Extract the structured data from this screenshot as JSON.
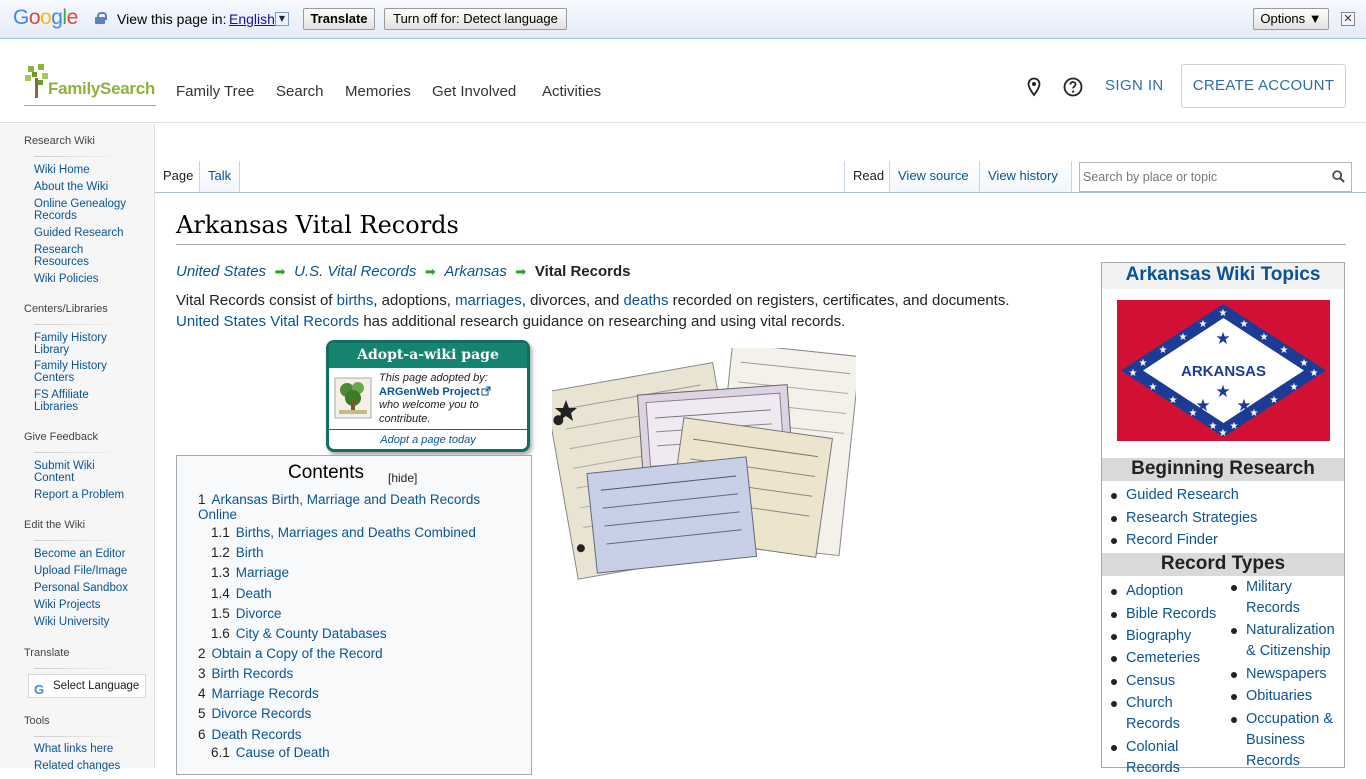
{
  "translate_bar": {
    "label": "View this page in:",
    "language": "English",
    "dropdown_glyph": "▼",
    "translate_button": "Translate",
    "turn_off_button": "Turn off for: Detect language",
    "options_button": "Options ▼",
    "close_glyph": "✕"
  },
  "header": {
    "logo_text": "FamilySearch",
    "nav": [
      "Family Tree",
      "Search",
      "Memories",
      "Get Involved",
      "Activities"
    ],
    "sign_in": "SIGN IN",
    "create_account": "CREATE ACCOUNT"
  },
  "sidebar": {
    "sections": [
      {
        "heading": "Research Wiki",
        "items": [
          "Wiki Home",
          "About the Wiki",
          "Online Genealogy Records",
          "Guided Research",
          "Research Resources",
          "Wiki Policies"
        ]
      },
      {
        "heading": "Centers/Libraries",
        "items": [
          "Family History Library",
          "Family History Centers",
          "FS Affiliate Libraries"
        ]
      },
      {
        "heading": "Give Feedback",
        "items": [
          "Submit Wiki Content",
          "Report a Problem"
        ]
      },
      {
        "heading": "Edit the Wiki",
        "items": [
          "Become an Editor",
          "Upload File/Image",
          "Personal Sandbox",
          "Wiki Projects",
          "Wiki University"
        ]
      },
      {
        "heading": "Translate",
        "items": []
      },
      {
        "heading": "Tools",
        "items": [
          "What links here",
          "Related changes"
        ]
      }
    ],
    "select_language": "Select Language"
  },
  "tabs": {
    "left": [
      "Page",
      "Talk"
    ],
    "right": [
      "Read",
      "View source",
      "View history"
    ],
    "search_placeholder": "Search by place or topic"
  },
  "page": {
    "title": "Arkansas Vital Records",
    "breadcrumbs": [
      "United States",
      "U.S. Vital Records",
      "Arkansas"
    ],
    "breadcrumb_current": "Vital Records",
    "intro": {
      "t1": "Vital Records consist of ",
      "l1": "births",
      "t2": ", adoptions, ",
      "l2": "marriages",
      "t3": ", divorces, and ",
      "l3": "deaths",
      "t4": " recorded on registers, certificates, and documents.",
      "l4": "United States Vital Records",
      "t5": " has additional research guidance on researching and using vital records."
    }
  },
  "adopt": {
    "title": "Adopt-a-wiki page",
    "line1": "This page adopted by:",
    "project": "ARGenWeb Project",
    "line2": "who welcome you to contribute.",
    "footer": "Adopt a page today"
  },
  "toc": {
    "title": "Contents",
    "hide": "[hide]",
    "items": [
      {
        "num": "1",
        "text": "Arkansas Birth, Marriage and Death Records Online"
      },
      {
        "num": "1.1",
        "text": "Births, Marriages and Deaths Combined"
      },
      {
        "num": "1.2",
        "text": "Birth"
      },
      {
        "num": "1.3",
        "text": "Marriage"
      },
      {
        "num": "1.4",
        "text": "Death"
      },
      {
        "num": "1.5",
        "text": "Divorce"
      },
      {
        "num": "1.6",
        "text": "City & County Databases"
      },
      {
        "num": "2",
        "text": "Obtain a Copy of the Record"
      },
      {
        "num": "3",
        "text": "Birth Records"
      },
      {
        "num": "4",
        "text": "Marriage Records"
      },
      {
        "num": "5",
        "text": "Divorce Records"
      },
      {
        "num": "6",
        "text": "Death Records"
      },
      {
        "num": "6.1",
        "text": "Cause of Death"
      }
    ]
  },
  "infobox": {
    "title": "Arkansas Wiki Topics",
    "flag_text": "ARKANSAS",
    "beginning_heading": "Beginning Research",
    "beginning": [
      "Guided Research",
      "Research Strategies",
      "Record Finder"
    ],
    "record_types_heading": "Record Types",
    "col1": [
      "Adoption",
      "Bible Records",
      "Biography",
      "Cemeteries",
      "Census",
      "Church Records",
      "Colonial Records"
    ],
    "col2": [
      "Military Records",
      "Naturalization & Citizenship",
      "Newspapers",
      "Obituaries",
      "Occupation & Business Records"
    ]
  },
  "colors": {
    "link": "#0b5394",
    "adopt_green": "#14846f",
    "flag_red": "#d21034",
    "flag_blue": "#1b3c96",
    "brand_green": "#8cb43c"
  }
}
